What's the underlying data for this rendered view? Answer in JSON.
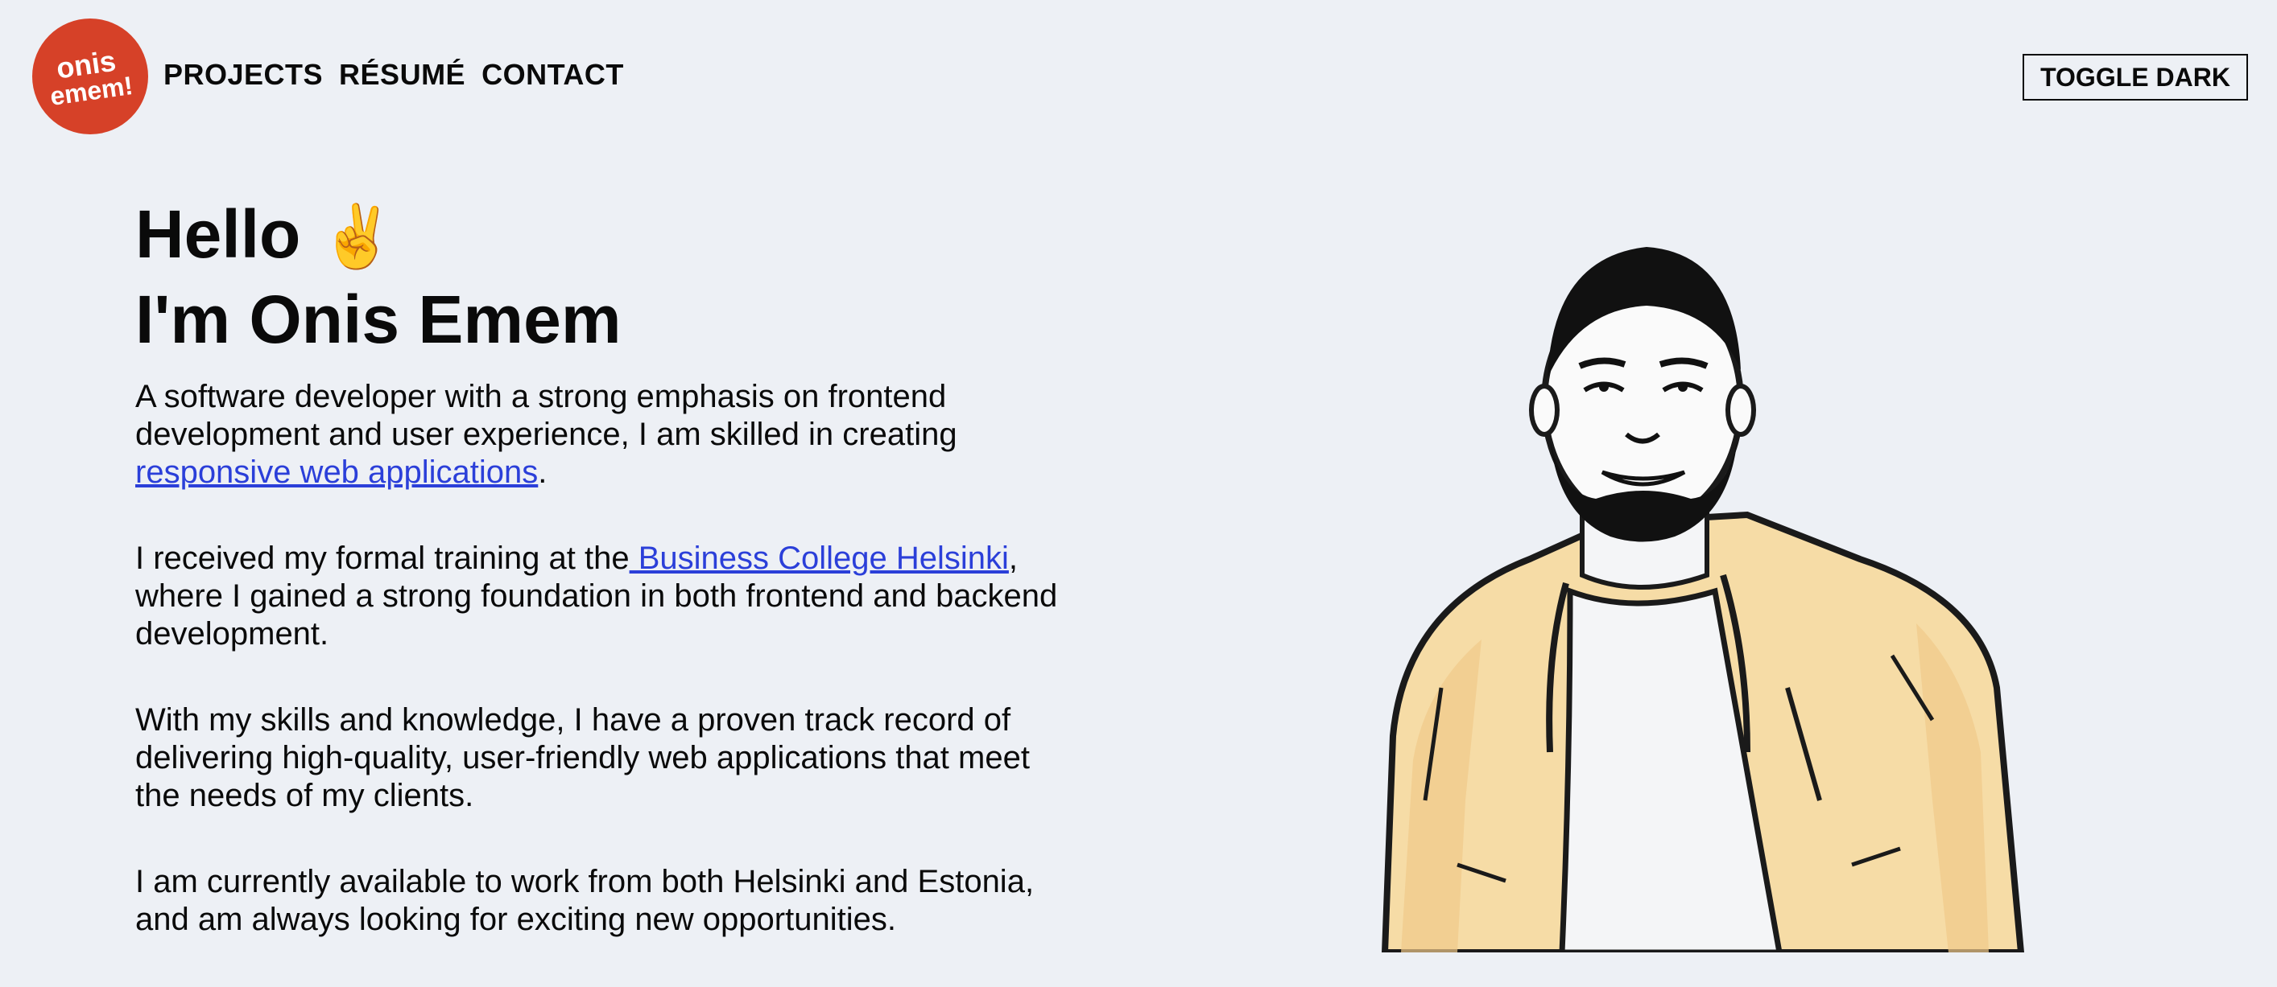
{
  "logo": {
    "line1": "onis",
    "line2": "emem!",
    "color": "#d64128"
  },
  "nav": {
    "items": [
      {
        "label": "PROJECTS"
      },
      {
        "label": "RÉSUMÉ"
      },
      {
        "label": "CONTACT"
      }
    ]
  },
  "toggle": {
    "label": "TOGGLE DARK"
  },
  "intro": {
    "greeting": "Hello",
    "greeting_emoji": "✌️",
    "name_line": "I'm Onis Emem",
    "p1": {
      "text_before": "A software developer with a strong emphasis on frontend development and user experience, I am skilled in creating ",
      "link": "responsive web applications",
      "text_after": "."
    },
    "p2": {
      "text_before": "I received my formal training at the",
      "link": " Business College Helsinki",
      "text_after": ", where I gained a strong foundation in both frontend and backend development."
    },
    "p3": "With my skills and knowledge, I have a proven track record of delivering high-quality, user-friendly web applications that meet the needs of my clients.",
    "p4": "I am currently available to work from both Helsinki and Estonia, and am always looking for exciting new opportunities."
  },
  "colors": {
    "background": "#edf0f5",
    "link": "#2b3fd9",
    "jacket": "#f6dca6"
  },
  "portrait": {
    "icon": "portrait-illustration"
  }
}
